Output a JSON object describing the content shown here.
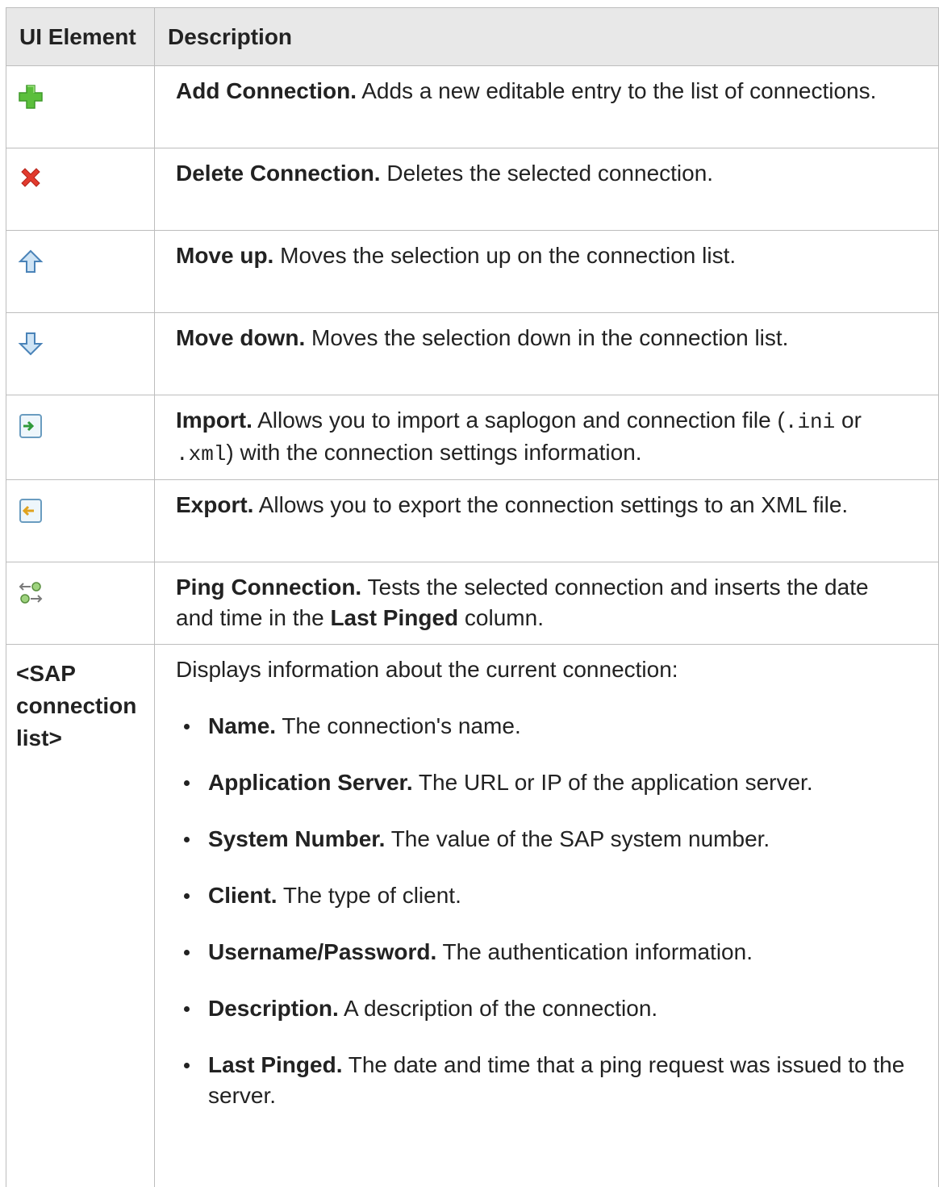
{
  "table": {
    "headers": {
      "element": "UI Element",
      "description": "Description"
    },
    "rows": [
      {
        "icon": "add-connection-icon",
        "title": "Add Connection.",
        "text": " Adds a new editable entry to the list of connections."
      },
      {
        "icon": "delete-connection-icon",
        "title": "Delete Connection.",
        "text": " Deletes the selected connection."
      },
      {
        "icon": "move-up-icon",
        "title": "Move up.",
        "text": " Moves the selection up on the connection list."
      },
      {
        "icon": "move-down-icon",
        "title": "Move down.",
        "text": " Moves the selection down in the connection list."
      },
      {
        "icon": "import-icon",
        "title": "Import.",
        "text_a": " Allows you to import a saplogon and connection file (",
        "code_a": ".ini",
        "text_b": " or ",
        "code_b": ".xml",
        "text_c": ") with the connection settings information."
      },
      {
        "icon": "export-icon",
        "title": "Export.",
        "text": " Allows you to export the connection settings to an XML file."
      },
      {
        "icon": "ping-connection-icon",
        "title": "Ping Connection.",
        "text_a": " Tests the selected connection and inserts the date and time in the ",
        "bold": "Last Pinged",
        "text_b": " column."
      }
    ],
    "list_row": {
      "element_label": "<SAP connection list>",
      "intro": "Displays information about the current connection:",
      "items": [
        {
          "term": "Name.",
          "text": " The connection's name."
        },
        {
          "term": "Application Server.",
          "text": " The URL or IP of the application server."
        },
        {
          "term": "System Number.",
          "text": " The value of the SAP system number."
        },
        {
          "term": "Client.",
          "text": " The type of client."
        },
        {
          "term": "Username/Password.",
          "text": " The authentication information."
        },
        {
          "term": "Description.",
          "text": " A description of the connection."
        },
        {
          "term": "Last Pinged.",
          "text": " The date and time that a ping request was issued to the server."
        }
      ]
    }
  }
}
